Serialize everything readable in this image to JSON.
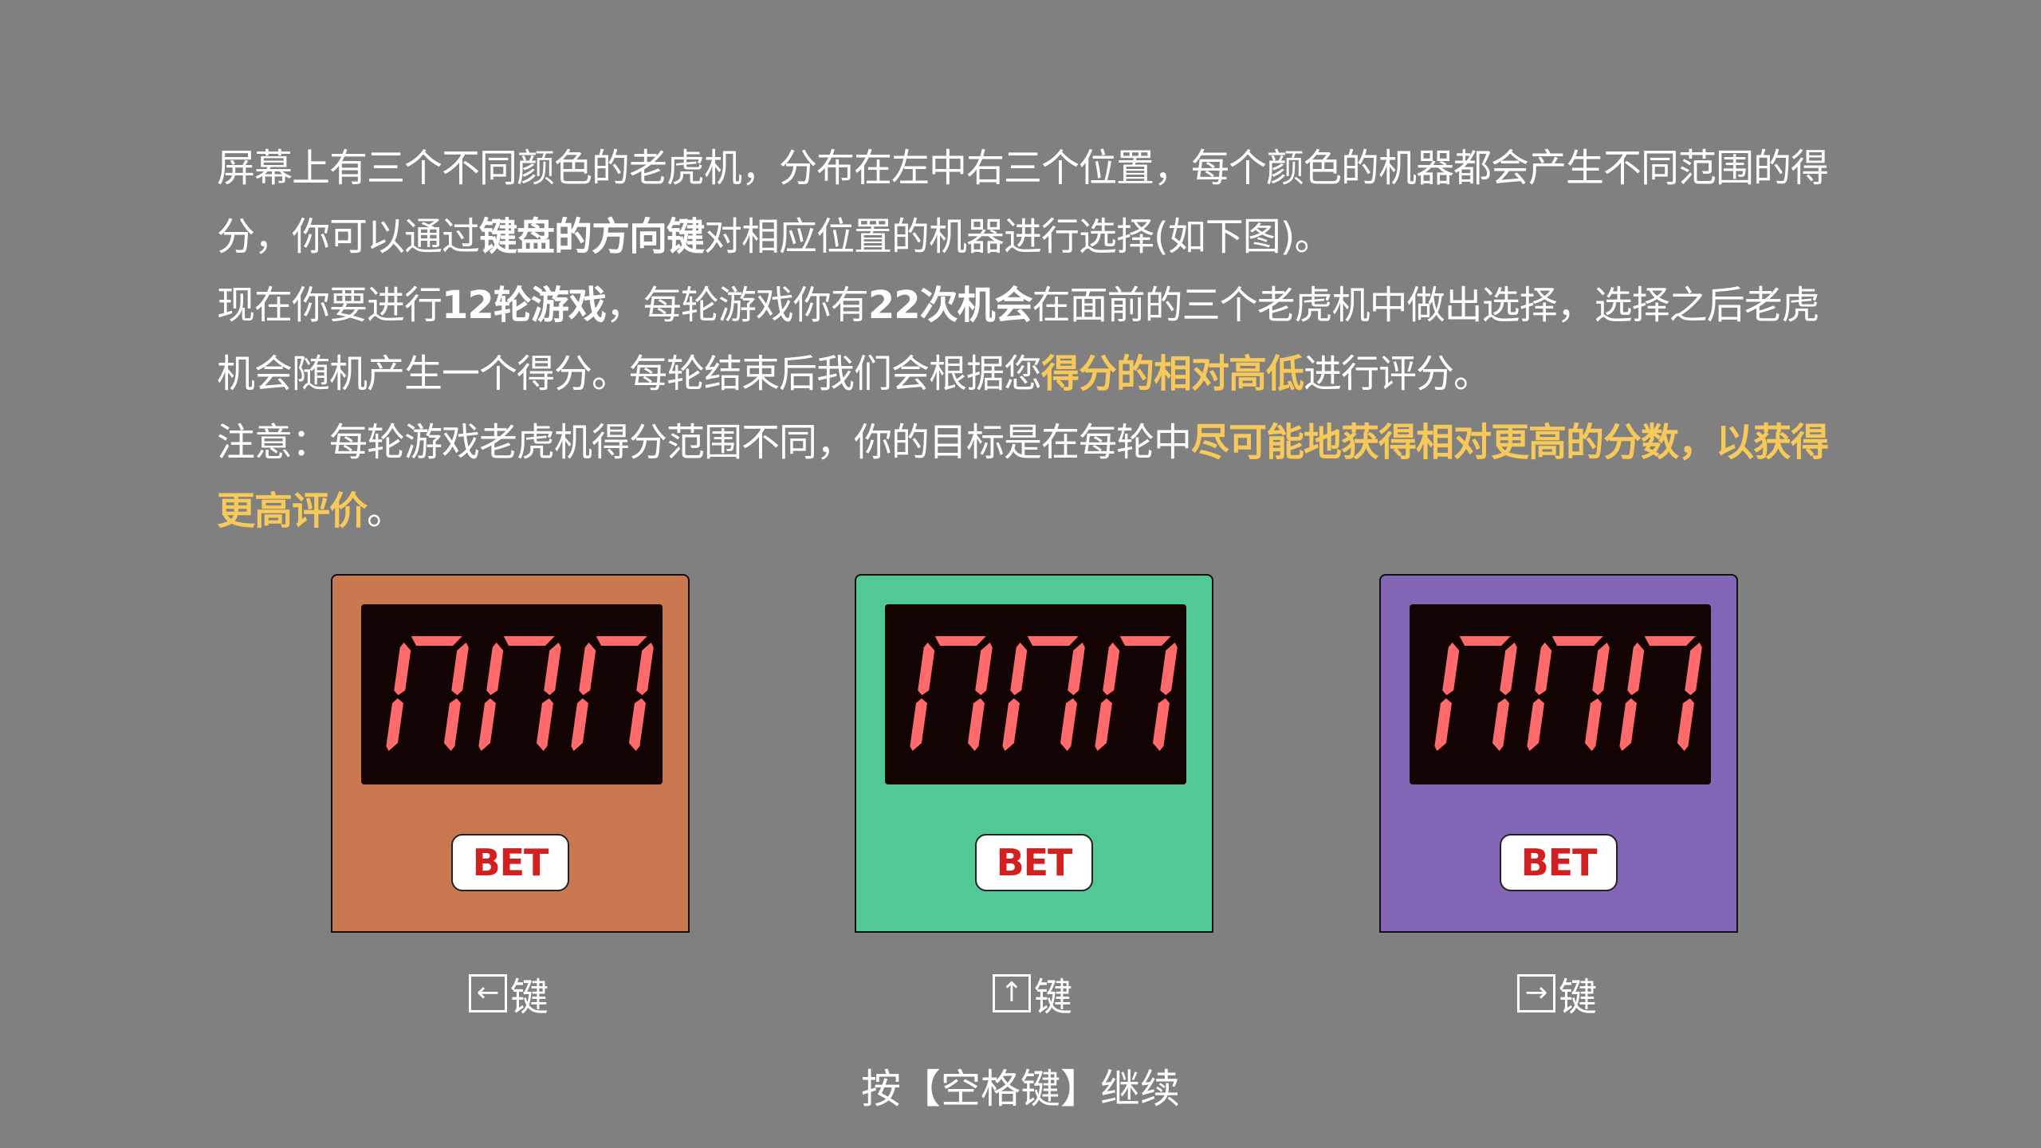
{
  "instructions": {
    "p1_a": "屏幕上有三个不同颜色的老虎机，分布在左中右三个位置，每个颜色的机器都会产生不同范围的得分，你可以通过",
    "p1_b": "键盘的方向键",
    "p1_c": "对相应位置的机器进行选择(如下图)。",
    "p2_a": "现在你要进行",
    "p2_b": "12轮游戏",
    "p2_c": "，每轮游戏你有",
    "p2_d": "22次机会",
    "p2_e": "在面前的三个老虎机中做出选择，选择之后老虎机会随机产生一个得分。每轮结束后我们会根据您",
    "p2_f": "得分的相对高低",
    "p2_g": "进行评分。",
    "p3_a": "注意：每轮游戏老虎机得分范围不同，你的目标是在每轮中",
    "p3_b": "尽可能地获得相对更高的分数，以获得更高评价",
    "p3_c": "。"
  },
  "machines": [
    {
      "id": "left",
      "color": "#c97850",
      "bet_label": "BET",
      "key_symbol": "←",
      "key_label": "键"
    },
    {
      "id": "center",
      "color": "#52c896",
      "bet_label": "BET",
      "key_symbol": "↑",
      "key_label": "键"
    },
    {
      "id": "right",
      "color": "#8366b5",
      "bet_label": "BET",
      "key_symbol": "→",
      "key_label": "键"
    }
  ],
  "display": {
    "segment_color": "#ff6b6b",
    "screen_color": "#140404"
  },
  "continue_hint": "按【空格键】继续"
}
